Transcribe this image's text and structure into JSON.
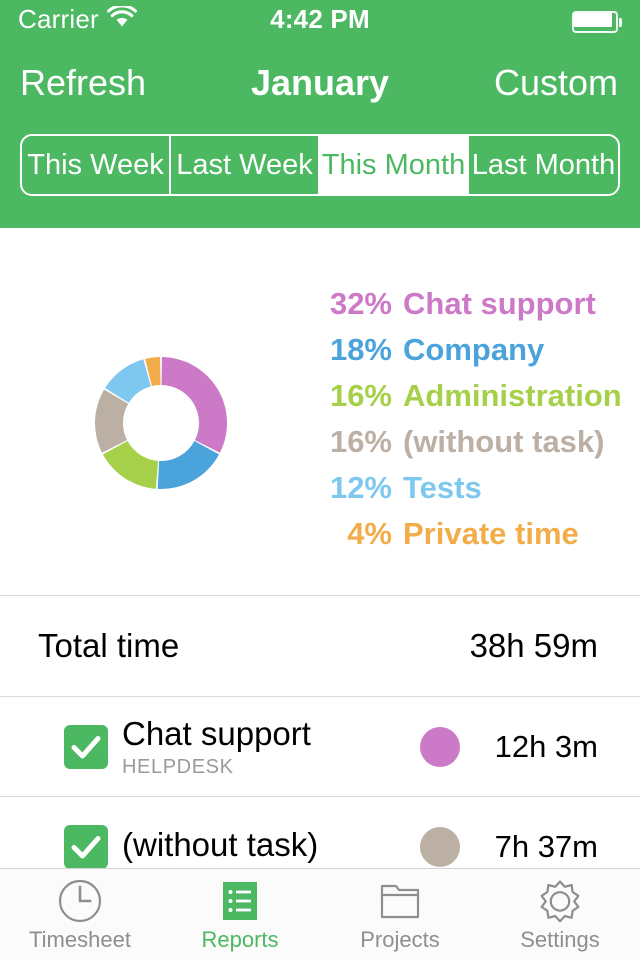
{
  "status_bar": {
    "carrier": "Carrier",
    "wifi_icon": "wifi-icon",
    "time": "4:42 PM",
    "battery_icon": "battery-full-icon"
  },
  "navbar": {
    "left_button": "Refresh",
    "title": "January",
    "right_button": "Custom"
  },
  "segmented_control": {
    "options": [
      {
        "label": "This Week",
        "selected": false
      },
      {
        "label": "Last Week",
        "selected": false
      },
      {
        "label": "This Month",
        "selected": true
      },
      {
        "label": "Last Month",
        "selected": false
      }
    ]
  },
  "colors": {
    "brand_green": "#4CB862",
    "chat_support": "#CC7AC8",
    "company": "#4BA3DC",
    "administration": "#A6D049",
    "without_task": "#BCAFA4",
    "tests": "#7EC8F0",
    "private_time": "#F2AD4A"
  },
  "chart_data": {
    "type": "pie",
    "title": "",
    "donut": true,
    "legend_position": "right",
    "categories": [
      "Chat support",
      "Company",
      "Administration",
      "(without task)",
      "Tests",
      "Private time"
    ],
    "values": [
      32,
      18,
      16,
      16,
      12,
      4
    ],
    "value_suffix": "%",
    "colors": [
      "#CC7AC8",
      "#4BA3DC",
      "#A6D049",
      "#BCAFA4",
      "#7EC8F0",
      "#F2AD4A"
    ],
    "legend": [
      {
        "pct": "32%",
        "label": "Chat support",
        "color": "#CC7AC8"
      },
      {
        "pct": "18%",
        "label": "Company",
        "color": "#4BA3DC"
      },
      {
        "pct": "16%",
        "label": "Administration",
        "color": "#A6D049"
      },
      {
        "pct": "16%",
        "label": "(without task)",
        "color": "#BCAFA4"
      },
      {
        "pct": "12%",
        "label": "Tests",
        "color": "#7EC8F0"
      },
      {
        "pct": "4%",
        "label": "Private time",
        "color": "#F2AD4A"
      }
    ]
  },
  "list": {
    "total": {
      "label": "Total time",
      "value": "38h 59m"
    },
    "rows": [
      {
        "checked": true,
        "title": "Chat support",
        "subtitle": "HELPDESK",
        "dot_color": "#CC7AC8",
        "value": "12h 3m"
      },
      {
        "checked": true,
        "title": "(without task)",
        "subtitle": "",
        "dot_color": "#BCAFA4",
        "value": "7h 37m"
      }
    ]
  },
  "tabbar": {
    "tabs": [
      {
        "label": "Timesheet",
        "icon": "clock-icon",
        "active": false
      },
      {
        "label": "Reports",
        "icon": "list-icon",
        "active": true
      },
      {
        "label": "Projects",
        "icon": "folder-icon",
        "active": false
      },
      {
        "label": "Settings",
        "icon": "gear-icon",
        "active": false
      }
    ]
  }
}
